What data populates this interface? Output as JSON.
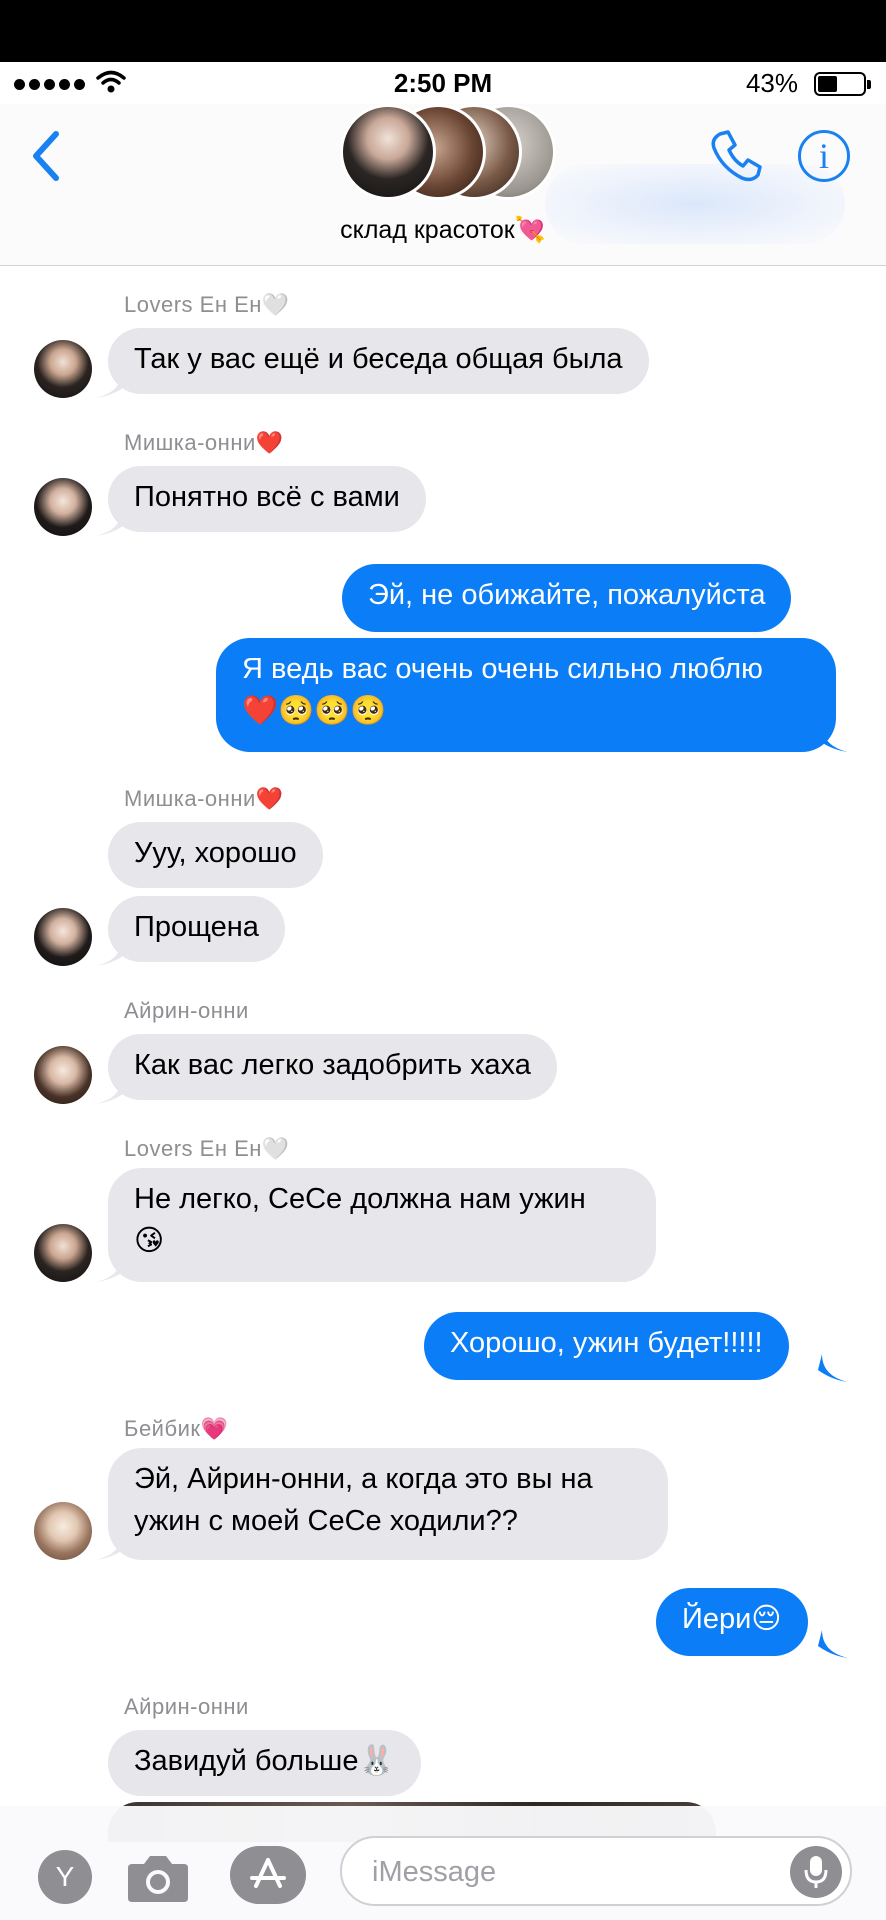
{
  "status_bar": {
    "time": "2:50 PM",
    "battery_pct": "43%",
    "battery_level": 0.43
  },
  "header": {
    "group_name": "склад красоток💘"
  },
  "messages": {
    "m1": {
      "sender": "Lovers Ен Ен🤍",
      "text": "Так у вас ещё и беседа общая была"
    },
    "m2": {
      "sender": "Мишка-онни❤️",
      "text": "Понятно всё с вами"
    },
    "m3": {
      "text": "Эй, не обижайте, пожалуйста"
    },
    "m4": {
      "line1": "Я ведь вас очень очень сильно люблю",
      "line2": "❤️🥺🥺🥺"
    },
    "m5": {
      "sender": "Мишка-онни❤️",
      "text": "Ууу, хорошо"
    },
    "m6": {
      "text": "Прощена"
    },
    "m7": {
      "sender": "Айрин-онни",
      "text": "Как вас легко задобрить хаха"
    },
    "m8": {
      "sender": "Lovers Ен Ен🤍",
      "line1": "Не легко, СеСе должна нам ужин",
      "line2": "😘"
    },
    "m9": {
      "text": "Хорошо, ужин будет!!!!!"
    },
    "m10": {
      "sender": "Бейбик💗",
      "line1": "Эй, Айрин-онни, а когда это вы на",
      "line2": "ужин с моей СеСе ходили??"
    },
    "m11": {
      "text": "Йери😔"
    },
    "m12": {
      "sender": "Айрин-онни",
      "text": "Завидуй больше🐰"
    }
  },
  "composer": {
    "placeholder": "iMessage",
    "y_app_label": "Y"
  },
  "icons": [
    "back-chevron-icon",
    "phone-icon",
    "info-icon",
    "camera-icon",
    "app-store-icon",
    "microphone-icon",
    "wifi-icon",
    "battery-icon"
  ],
  "colors": {
    "accent": "#0b7df6",
    "incoming": "#e6e6eb",
    "link": "#1a82f0"
  }
}
